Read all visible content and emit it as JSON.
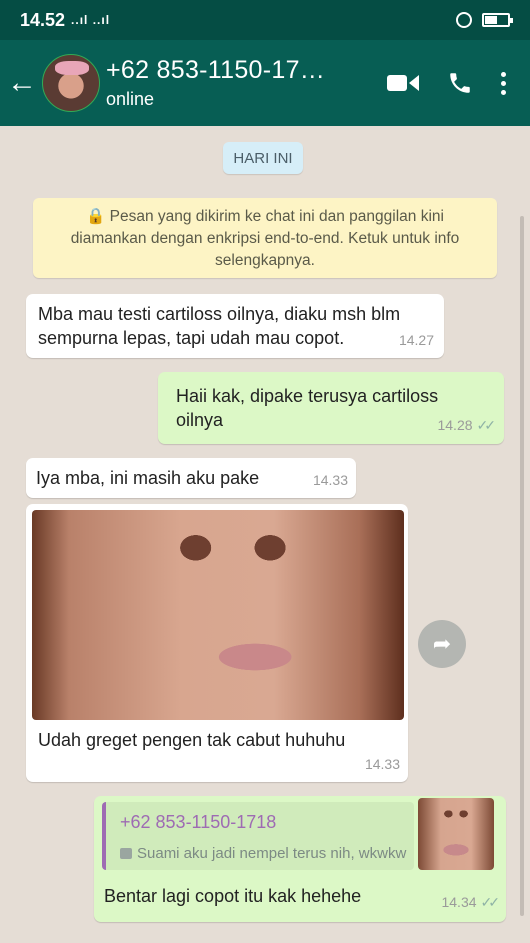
{
  "status_bar": {
    "time": "14.52",
    "signal": "..ıl ..ıl"
  },
  "header": {
    "contact": "+62 853-1150-17…",
    "status": "online",
    "back_icon": "arrow-left-icon",
    "video_icon": "video-call-icon",
    "call_icon": "phone-icon",
    "menu_icon": "more-vertical-icon"
  },
  "chat": {
    "date_chip": "HARI INI",
    "encryption_notice": "🔒 Pesan yang dikirim ke chat ini dan panggilan kini diamankan dengan enkripsi end-to-end. Ketuk untuk info selengkapnya.",
    "messages": [
      {
        "dir": "in",
        "text": "Mba mau testi cartiloss oilnya, diaku msh blm sempurna lepas, tapi udah mau copot.",
        "time": "14.27"
      },
      {
        "dir": "out",
        "text": "Haii kak, dipake terusya cartiloss oilnya",
        "time": "14.28",
        "ticks": "✓✓"
      },
      {
        "dir": "in",
        "text": "Iya mba, ini masih aku pake",
        "time": "14.33"
      },
      {
        "dir": "in",
        "caption": "Udah greget pengen tak cabut huhuhu",
        "time": "14.33"
      },
      {
        "dir": "out",
        "quote_name": "+62 853-1150-1718",
        "quote_text": "Suami aku jadi nempel terus nih, wkwkw",
        "text": "Bentar lagi copot itu kak hehehe",
        "time": "14.34",
        "ticks": "✓✓"
      }
    ]
  },
  "colors": {
    "header": "#075e54",
    "status_bar": "#054d44",
    "outgoing": "#dcf8c6",
    "background": "#e5ddd5"
  }
}
